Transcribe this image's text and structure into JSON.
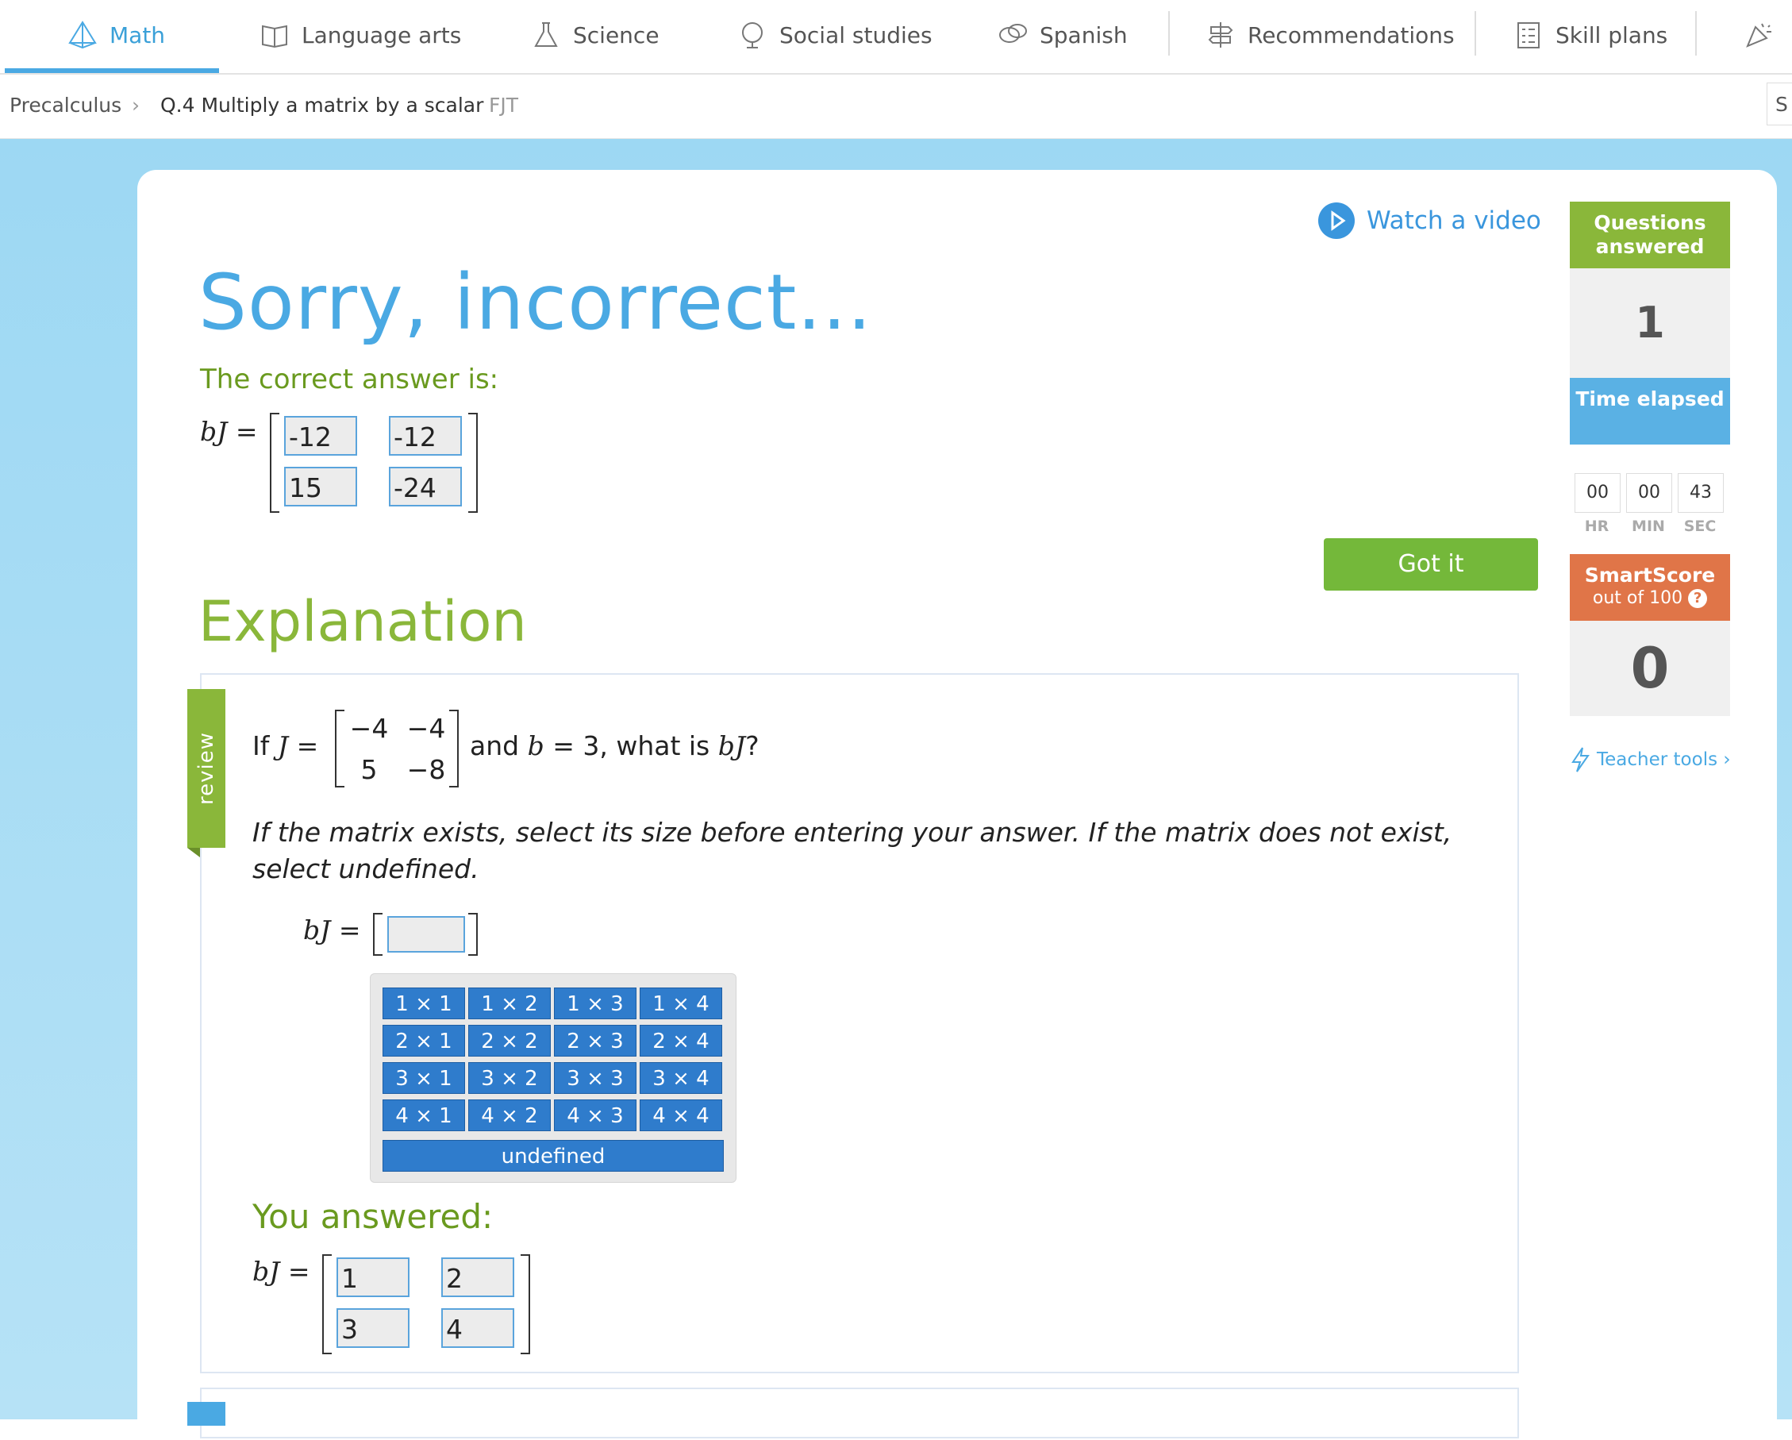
{
  "nav": {
    "tabs": [
      {
        "label": "Math",
        "icon": "math-pyramid-icon"
      },
      {
        "label": "Language arts",
        "icon": "book-icon"
      },
      {
        "label": "Science",
        "icon": "flask-icon"
      },
      {
        "label": "Social studies",
        "icon": "globe-icon"
      },
      {
        "label": "Spanish",
        "icon": "speech-bubbles-icon"
      },
      {
        "label": "Recommendations",
        "icon": "signpost-icon"
      },
      {
        "label": "Skill plans",
        "icon": "checklist-icon"
      }
    ],
    "active": "Math"
  },
  "breadcrumb": {
    "subject": "Precalculus",
    "skill": "Q.4 Multiply a matrix by a scalar",
    "code": "FJT",
    "right_edge": "S"
  },
  "feedback": {
    "title": "Sorry, incorrect...",
    "correct_label": "The correct answer is:",
    "lhs": "bJ =",
    "correct_matrix": [
      [
        "-12",
        "-12"
      ],
      [
        "15",
        "-24"
      ]
    ],
    "watch_video": "Watch a video",
    "got_it": "Got it"
  },
  "explanation": {
    "heading": "Explanation",
    "review_tab": "review",
    "question_if": "If",
    "question_J": "J =",
    "J_matrix": [
      [
        "−4",
        "−4"
      ],
      [
        "5",
        "−8"
      ]
    ],
    "question_rest_and": "and",
    "question_b": "b",
    "question_eq3": "= 3, what is",
    "question_bJ": "bJ",
    "question_qmark": "?",
    "instruction": "If the matrix exists, select its size before entering your answer. If the matrix does not exist, select undefined.",
    "lhs": "bJ =",
    "sizes": [
      [
        "1 × 1",
        "1 × 2",
        "1 × 3",
        "1 × 4"
      ],
      [
        "2 × 1",
        "2 × 2",
        "2 × 3",
        "2 × 4"
      ],
      [
        "3 × 1",
        "3 × 2",
        "3 × 3",
        "3 × 4"
      ],
      [
        "4 × 1",
        "4 × 2",
        "4 × 3",
        "4 × 4"
      ]
    ],
    "undefined_label": "undefined",
    "you_answered": "You answered:",
    "answered_matrix": [
      [
        "1",
        "2"
      ],
      [
        "3",
        "4"
      ]
    ]
  },
  "sidebar": {
    "questions_label": "Questions answered",
    "questions_value": "1",
    "time_label": "Time elapsed",
    "time_hr": "00",
    "time_min": "00",
    "time_sec": "43",
    "hr_label": "HR",
    "min_label": "MIN",
    "sec_label": "SEC",
    "smartscore_label": "SmartScore",
    "smartscore_sub": "out of 100",
    "smartscore_value": "0",
    "teacher_tools": "Teacher tools ›"
  },
  "colors": {
    "accent_blue": "#4aa9e3",
    "green": "#8ab73a",
    "dark_green": "#6a9a1f",
    "time_blue": "#5ab1e4",
    "smartscore_orange": "#e07548",
    "button_green": "#74b83a"
  }
}
